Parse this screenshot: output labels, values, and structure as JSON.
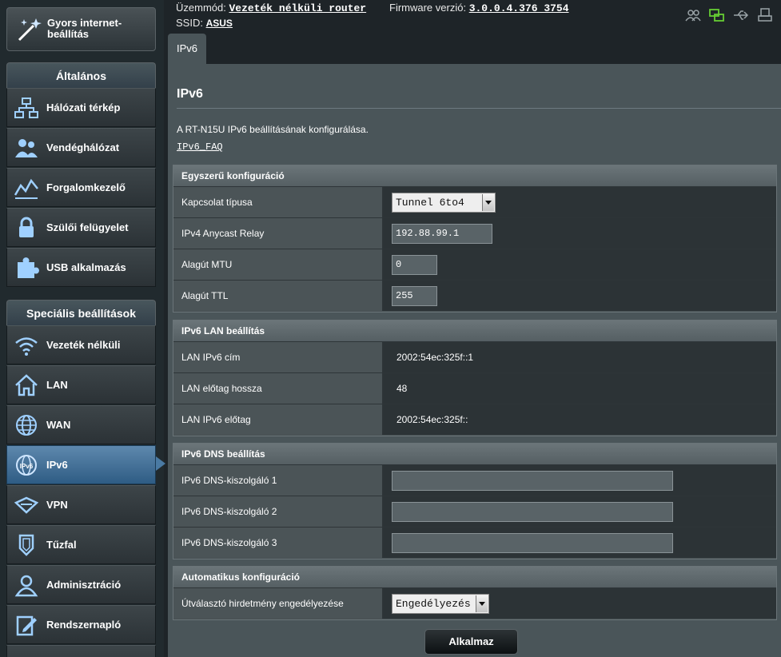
{
  "sidebar": {
    "quick_setup": "Gyors internet-beállítás",
    "general_header": "Általános",
    "general_items": [
      {
        "label": "Hálózati térkép",
        "icon": "network-map-icon"
      },
      {
        "label": "Vendéghálózat",
        "icon": "guest-network-icon"
      },
      {
        "label": "Forgalomkezelő",
        "icon": "traffic-manager-icon"
      },
      {
        "label": "Szülői felügyelet",
        "icon": "lock-icon"
      },
      {
        "label": "USB alkalmazás",
        "icon": "puzzle-icon"
      }
    ],
    "advanced_header": "Speciális beállítások",
    "advanced_items": [
      {
        "label": "Vezeték nélküli",
        "icon": "wifi-icon"
      },
      {
        "label": "LAN",
        "icon": "home-icon"
      },
      {
        "label": "WAN",
        "icon": "globe-icon"
      },
      {
        "label": "IPv6",
        "icon": "ipv6-globe-icon"
      },
      {
        "label": "VPN",
        "icon": "vpn-icon"
      },
      {
        "label": "Tűzfal",
        "icon": "shield-icon"
      },
      {
        "label": "Adminisztráció",
        "icon": "admin-user-icon"
      },
      {
        "label": "Rendszernapló",
        "icon": "log-edit-icon"
      }
    ],
    "active_item": "IPv6"
  },
  "topbar": {
    "mode_label": "Üzemmód:",
    "mode_value": "Vezeték nélküli router",
    "firmware_label": "Firmware verzió:",
    "firmware_value": "3.0.0.4.376_3754",
    "ssid_label": "SSID:",
    "ssid_value": "ASUS",
    "status_icons": [
      "clients-icon",
      "network-status-icon",
      "usb-icon",
      "printer-icon"
    ]
  },
  "tab": {
    "label": "IPv6"
  },
  "main": {
    "title": "IPv6",
    "description": "A RT-N15U IPv6 beállításának konfigurálása.",
    "faq_link": "IPv6_FAQ",
    "basic": {
      "header": "Egyszerű konfiguráció",
      "connection_type_label": "Kapcsolat típusa",
      "connection_type_value": "Tunnel 6to4",
      "anycast_label": "IPv4 Anycast Relay",
      "anycast_value": "192.88.99.1",
      "mtu_label": "Alagút MTU",
      "mtu_value": "0",
      "ttl_label": "Alagút TTL",
      "ttl_value": "255"
    },
    "lan": {
      "header": "IPv6 LAN beállítás",
      "address_label": "LAN IPv6 cím",
      "address_value": "2002:54ec:325f::1",
      "prefix_len_label": "LAN előtag hossza",
      "prefix_len_value": "48",
      "prefix_label": "LAN IPv6 előtag",
      "prefix_value": "2002:54ec:325f::"
    },
    "dns": {
      "header": "IPv6 DNS beállítás",
      "dns1_label": "IPv6 DNS-kiszolgáló 1",
      "dns1_value": "",
      "dns2_label": "IPv6 DNS-kiszolgáló 2",
      "dns2_value": "",
      "dns3_label": "IPv6 DNS-kiszolgáló 3",
      "dns3_value": ""
    },
    "auto": {
      "header": "Automatikus konfiguráció",
      "ra_label": "Útválasztó hirdetmény engedélyezése",
      "ra_value": "Engedélyezés"
    },
    "apply_label": "Alkalmaz"
  },
  "colors": {
    "active_item": "#3f6f99",
    "panel": "#4a5559",
    "value_cell": "#2c3336"
  }
}
